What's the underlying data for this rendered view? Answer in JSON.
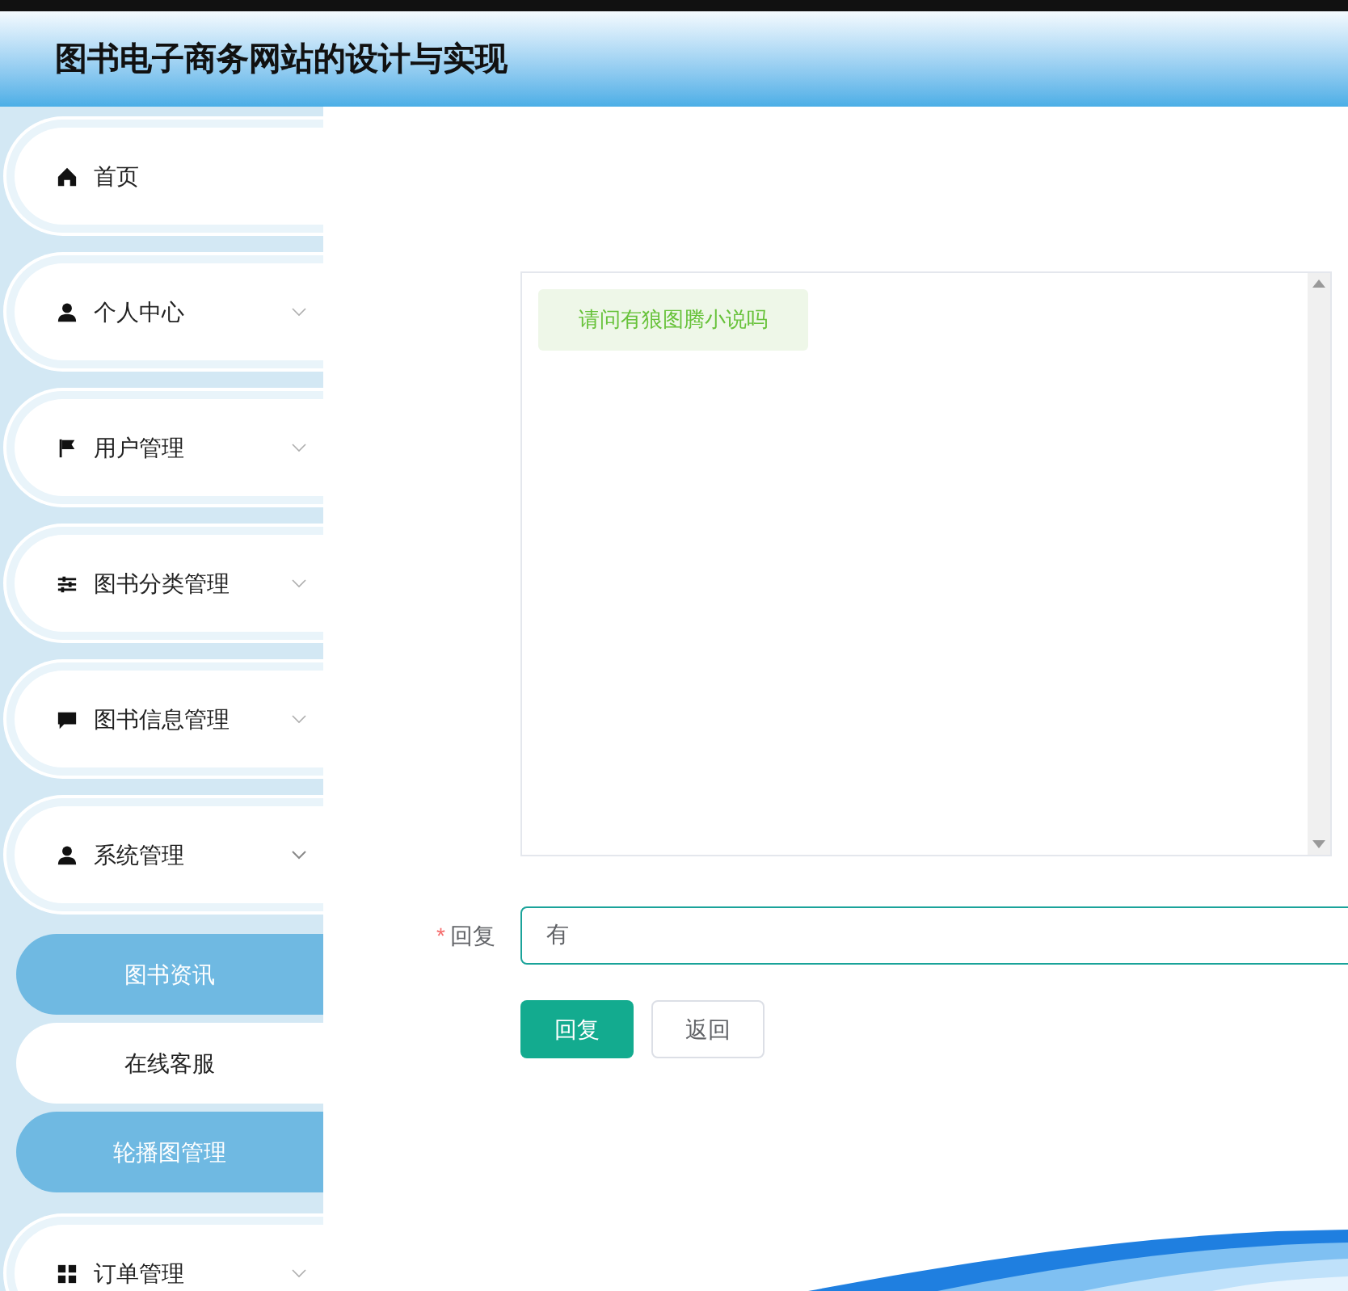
{
  "header": {
    "title": "图书电子商务网站的设计与实现"
  },
  "sidebar": {
    "items": [
      {
        "label": "首页",
        "kind": "link"
      },
      {
        "label": "个人中心",
        "kind": "menu",
        "expanded": false
      },
      {
        "label": "用户管理",
        "kind": "menu",
        "expanded": false
      },
      {
        "label": "图书分类管理",
        "kind": "menu",
        "expanded": false
      },
      {
        "label": "图书信息管理",
        "kind": "menu",
        "expanded": false
      },
      {
        "label": "系统管理",
        "kind": "menu",
        "expanded": true,
        "children": [
          {
            "label": "图书资讯",
            "selected": true
          },
          {
            "label": "在线客服",
            "selected": false
          },
          {
            "label": "轮播图管理",
            "selected": true
          }
        ]
      },
      {
        "label": "订单管理",
        "kind": "menu",
        "expanded": false
      }
    ]
  },
  "chat": {
    "messages": [
      {
        "text": "请问有狼图腾小说吗"
      }
    ]
  },
  "form": {
    "required_mark": "*",
    "label": "回复",
    "value": "有"
  },
  "buttons": [
    {
      "label": "回复",
      "kind": "primary"
    },
    {
      "label": "返回",
      "kind": "default"
    }
  ]
}
